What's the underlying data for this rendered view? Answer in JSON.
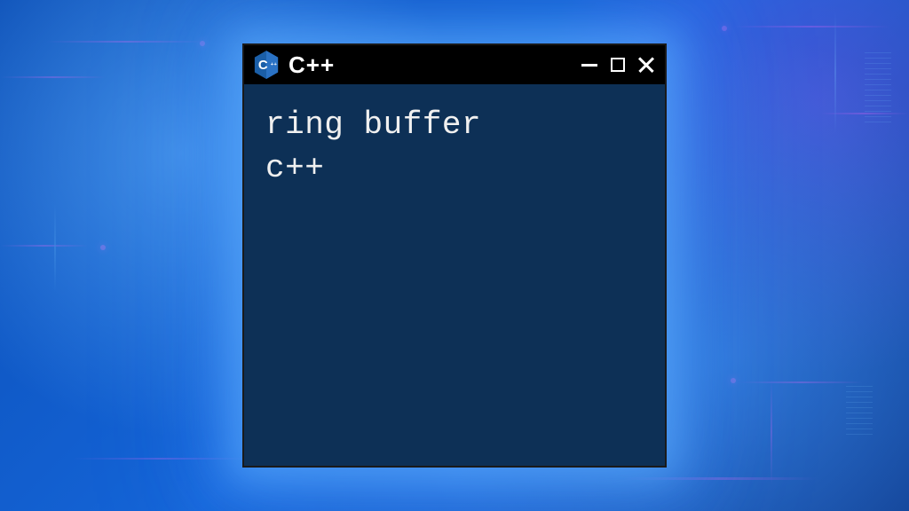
{
  "window": {
    "title": "C++",
    "icon_name": "cpp-logo"
  },
  "terminal": {
    "lines": [
      "ring buffer",
      "c++"
    ]
  },
  "colors": {
    "terminal_bg": "#0d3056",
    "titlebar_bg": "#000000",
    "text": "#f0f0f0",
    "glow": "#5ab4ff"
  }
}
